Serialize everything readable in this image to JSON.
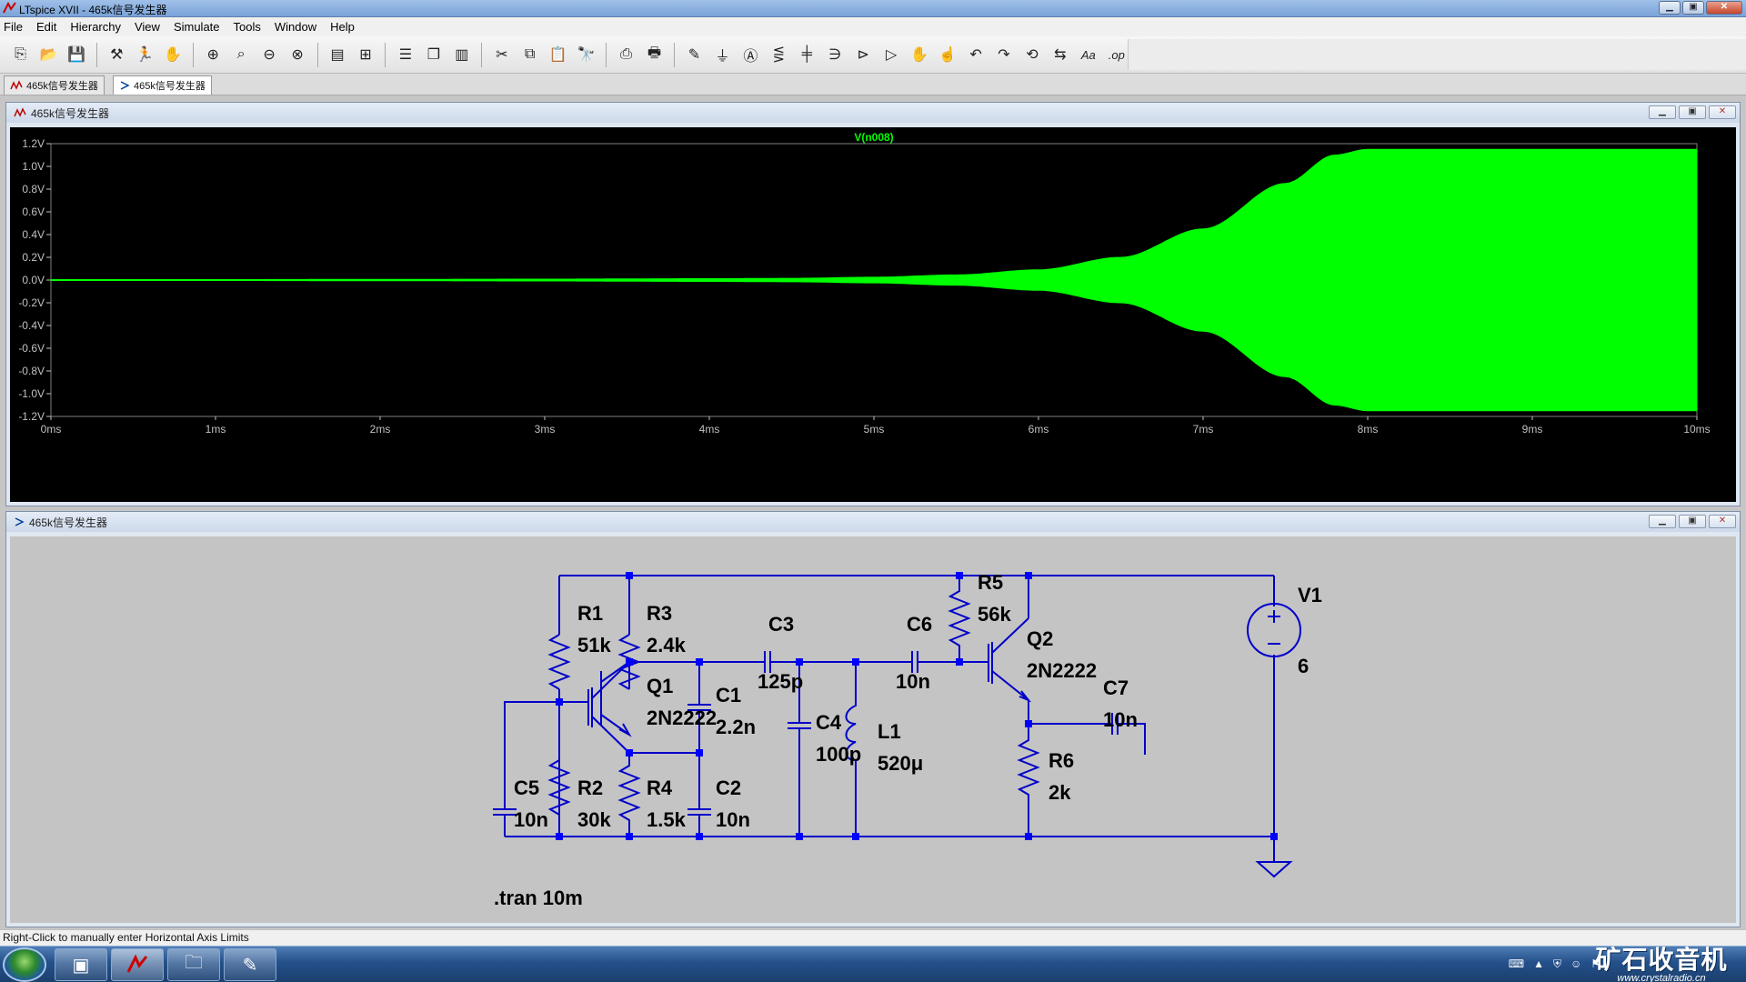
{
  "window": {
    "title": "LTspice XVII - 465k信号发生器",
    "min_label": "▁",
    "max_label": "▣",
    "close_label": "✕"
  },
  "menu": [
    "File",
    "Edit",
    "Hierarchy",
    "View",
    "Simulate",
    "Tools",
    "Window",
    "Help"
  ],
  "toolbar_icons": [
    "new-schematic-icon",
    "open-icon",
    "save-icon",
    "control-panel-icon",
    "run-icon",
    "halt-icon",
    "zoom-in-icon",
    "zoom-pan-icon",
    "zoom-out-icon",
    "zoom-fit-icon",
    "autorange-icon",
    "grid-icon",
    "tile-horizontal-icon",
    "cascade-icon",
    "tile-vertical-icon",
    "cut-icon",
    "copy-icon",
    "paste-icon",
    "find-icon",
    "print-icon",
    "print-setup-icon",
    "draw-wire-icon",
    "ground-icon",
    "label-icon",
    "resistor-icon",
    "capacitor-icon",
    "inductor-icon",
    "diode-icon",
    "component-icon",
    "move-icon",
    "drag-icon",
    "undo-icon",
    "redo-icon",
    "rotate-icon",
    "mirror-icon",
    "text-icon",
    "spice-directive-icon"
  ],
  "tabs": [
    {
      "label": "465k信号发生器",
      "kind": "waveform"
    },
    {
      "label": "465k信号发生器",
      "kind": "schematic"
    }
  ],
  "waveform_window": {
    "title": "465k信号发生器",
    "trace_name": "V(n008)",
    "trace_color": "#00ff00",
    "background": "#000000",
    "y_ticks": [
      "1.2V",
      "1.0V",
      "0.8V",
      "0.6V",
      "0.4V",
      "0.2V",
      "0.0V",
      "-0.2V",
      "-0.4V",
      "-0.6V",
      "-0.8V",
      "-1.0V",
      "-1.2V"
    ],
    "x_ticks": [
      "0ms",
      "1ms",
      "2ms",
      "3ms",
      "4ms",
      "5ms",
      "6ms",
      "7ms",
      "8ms",
      "9ms",
      "10ms"
    ]
  },
  "chart_data": {
    "type": "area",
    "title": "",
    "xlabel": "",
    "ylabel": "",
    "xlim": [
      0,
      10
    ],
    "ylim": [
      -1.2,
      1.2
    ],
    "series": [
      {
        "name": "V(n008)",
        "envelope_x_ms": [
          0,
          1,
          2,
          3,
          4,
          4.5,
          5,
          5.5,
          6,
          6.5,
          7,
          7.5,
          7.8,
          8,
          9,
          10
        ],
        "envelope_amplitude_v": [
          0.003,
          0.004,
          0.006,
          0.008,
          0.012,
          0.015,
          0.025,
          0.045,
          0.09,
          0.2,
          0.45,
          0.85,
          1.1,
          1.15,
          1.15,
          1.15
        ]
      }
    ]
  },
  "schematic_window": {
    "title": "465k信号发生器",
    "components": [
      {
        "ref": "R1",
        "value": "51k"
      },
      {
        "ref": "R3",
        "value": "2.4k"
      },
      {
        "ref": "Q1",
        "value": "2N2222"
      },
      {
        "ref": "C1",
        "value": "2.2n"
      },
      {
        "ref": "C3",
        "value": "125p"
      },
      {
        "ref": "C4",
        "value": "100p"
      },
      {
        "ref": "L1",
        "value": "520μ"
      },
      {
        "ref": "C6",
        "value": "10n"
      },
      {
        "ref": "R5",
        "value": "56k"
      },
      {
        "ref": "Q2",
        "value": "2N2222"
      },
      {
        "ref": "C7",
        "value": "10n"
      },
      {
        "ref": "R6",
        "value": "2k"
      },
      {
        "ref": "V1",
        "value": "6"
      },
      {
        "ref": "C5",
        "value": "10n"
      },
      {
        "ref": "R2",
        "value": "30k"
      },
      {
        "ref": "R4",
        "value": "1.5k"
      },
      {
        "ref": "C2",
        "value": "10n"
      }
    ],
    "directive": ".tran 10m",
    "wire_color": "#0000c8",
    "junction_color": "#0000ff",
    "label_color": "#000000"
  },
  "status": {
    "text": "Right-Click to manually enter Horizontal Axis Limits"
  },
  "taskbar": {
    "tray_time": "",
    "brand_name": "矿石收音机",
    "brand_url": "www.crystalradio.cn"
  }
}
